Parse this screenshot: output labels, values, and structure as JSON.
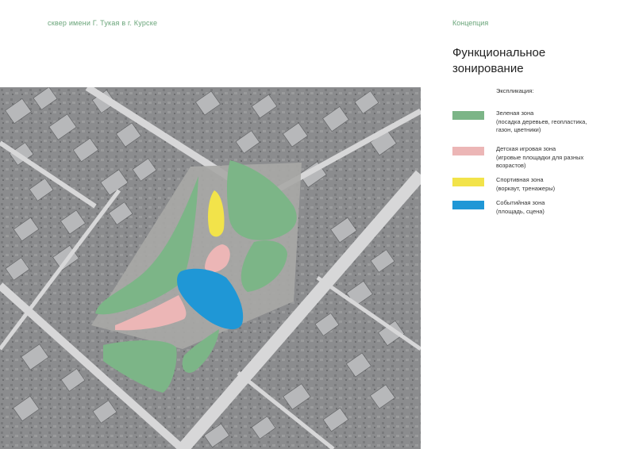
{
  "header": {
    "project": "сквер имени Г. Тукая в г. Курске",
    "section": "Концепция"
  },
  "title": {
    "line1": "Функциональное",
    "line2": "зонирование"
  },
  "explication_label": "Экспликация:",
  "legend": [
    {
      "color": "#7cb587",
      "label": "Зеленая зона",
      "detail1": "(посадка деревьев, геопластика,",
      "detail2": "газон, цветники)"
    },
    {
      "color": "#ecb6b6",
      "label": "Детская игровая зона",
      "detail1": "(игровые площадки для разных",
      "detail2": "возрастов)"
    },
    {
      "color": "#f2e34a",
      "label": "Спортивная зона",
      "detail1": "(воркаут, тренажеры)",
      "detail2": ""
    },
    {
      "color": "#1f97d6",
      "label": "Событийная зона",
      "detail1": "(площадь, сцена)",
      "detail2": ""
    }
  ],
  "zone_colors": {
    "green": "#7cb587",
    "pink": "#ecb6b6",
    "yellow": "#f2e34a",
    "blue": "#1f97d6"
  }
}
